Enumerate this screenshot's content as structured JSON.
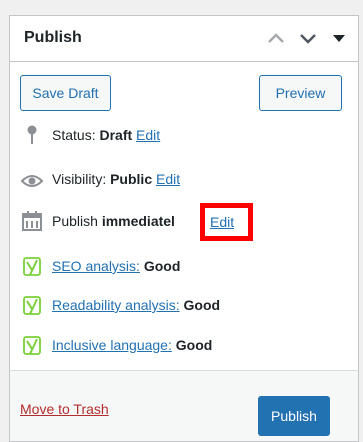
{
  "panel": {
    "title": "Publish",
    "header_icons": [
      "chevron-up-icon",
      "chevron-down-icon",
      "caret-down-icon"
    ]
  },
  "actions": {
    "save_draft": "Save Draft",
    "preview": "Preview"
  },
  "status": {
    "label": "Status:",
    "value": "Draft",
    "edit": "Edit",
    "icon": "pin-icon"
  },
  "visibility": {
    "label": "Visibility:",
    "value": "Public",
    "edit": "Edit",
    "icon": "eye-icon"
  },
  "schedule": {
    "label": "Publish",
    "value": "immediatel",
    "edit": "Edit",
    "icon": "calendar-icon"
  },
  "yoast": {
    "icon": "yoast-icon",
    "seo": {
      "link": "SEO analysis:",
      "value": "Good"
    },
    "readability": {
      "link": "Readability analysis:",
      "value": "Good"
    },
    "inclusive": {
      "link": "Inclusive language:",
      "value": "Good"
    }
  },
  "footer": {
    "trash": "Move to Trash",
    "publish": "Publish"
  },
  "colors": {
    "link": "#2271b1",
    "trash": "#b32d2e",
    "primary": "#2271b1",
    "highlight": "#ff0000",
    "yoast_green": "#7ad03a"
  }
}
